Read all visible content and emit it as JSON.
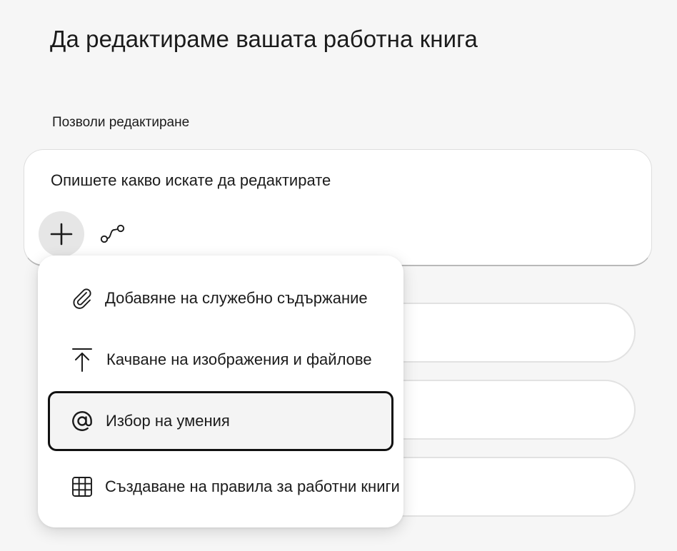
{
  "page": {
    "title": "Да редактираме вашата работна книга",
    "section_label": "Позволи редактиране"
  },
  "prompt": {
    "placeholder": "Опишете какво искате да редактирате",
    "value": "",
    "add_icon": "plus-icon",
    "flow_icon": "flow-icon"
  },
  "menu": {
    "items": [
      {
        "label": "Добавяне на служебно съдържание",
        "icon": "paperclip-icon",
        "selected": false
      },
      {
        "label": "Качване на изображения и файлове",
        "icon": "upload-icon",
        "selected": false
      },
      {
        "label": "Избор на умения",
        "icon": "at-sign-icon",
        "selected": true
      },
      {
        "label": "Създаване на правила за работни книги",
        "icon": "grid-icon",
        "selected": false
      }
    ]
  },
  "colors": {
    "background": "#f6f6f6",
    "surface": "#ffffff",
    "text": "#1b1b1b",
    "selected_border": "#111111"
  }
}
